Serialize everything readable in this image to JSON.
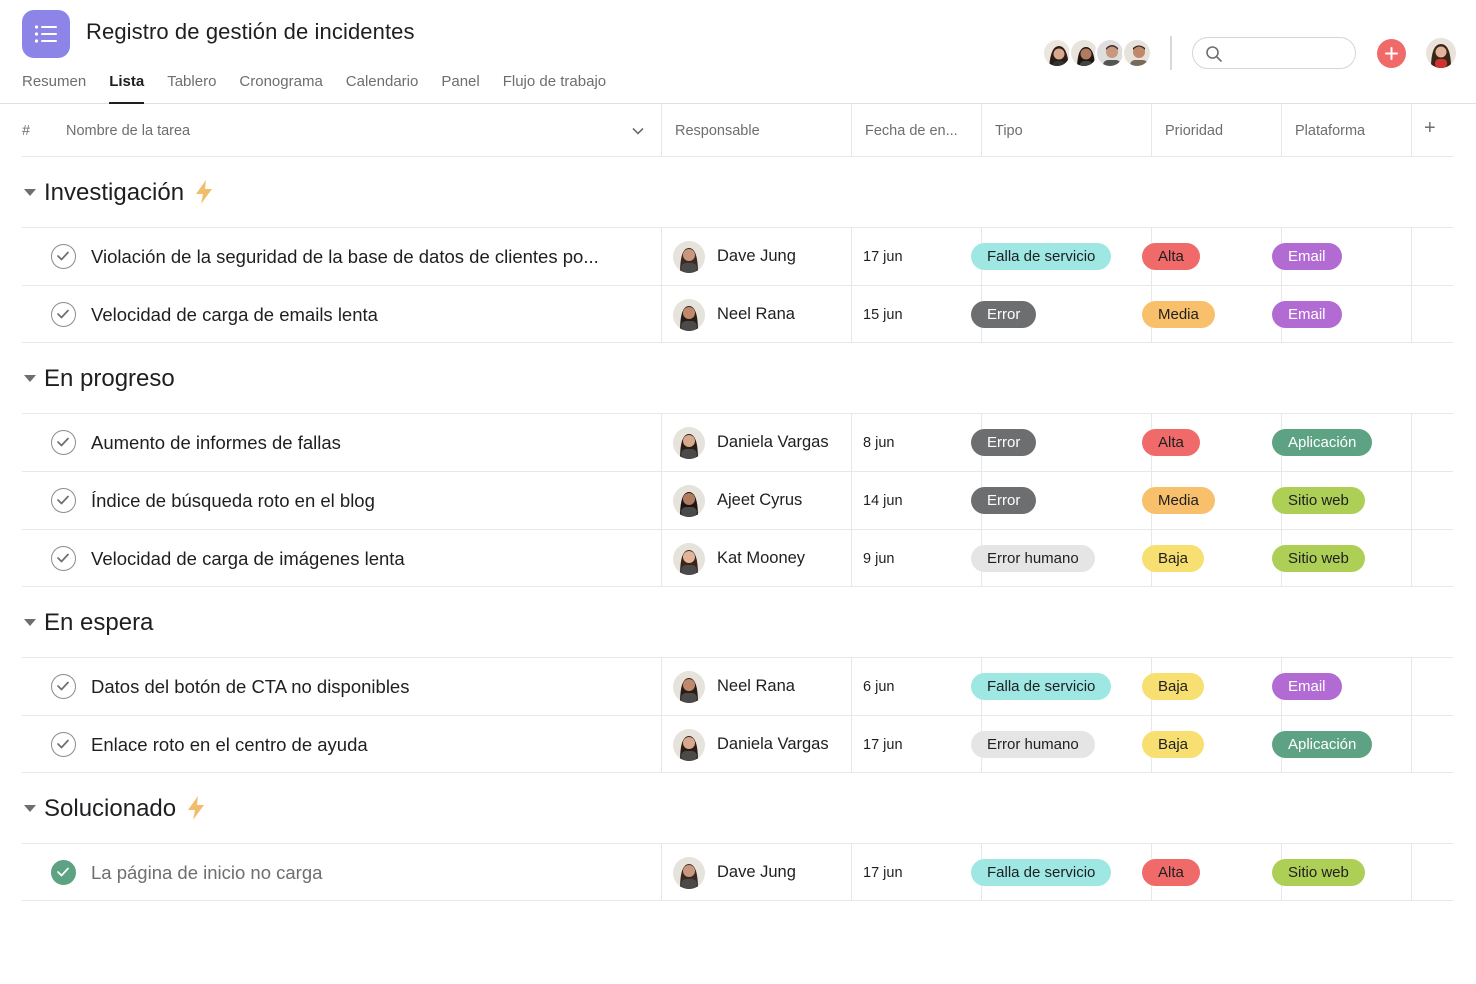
{
  "app": {
    "title": "Registro de gestión de incidentes",
    "tabs": [
      "Resumen",
      "Lista",
      "Tablero",
      "Cronograma",
      "Calendario",
      "Panel",
      "Flujo de trabajo"
    ],
    "active_tab": "Lista",
    "accent_color": "#8d84e8",
    "add_color": "#f06a6a"
  },
  "table": {
    "headers": {
      "number": "#",
      "task_name": "Nombre de la tarea",
      "assignee": "Responsable",
      "due_date": "Fecha de en...",
      "type": "Tipo",
      "priority": "Prioridad",
      "platform": "Plataforma",
      "add_column": "+"
    }
  },
  "sections": [
    {
      "title": "Investigación",
      "has_bolt": true,
      "tasks": [
        {
          "name": "Violación de la seguridad de la base de datos de clientes po...",
          "done": false,
          "assignee": "Dave Jung",
          "date": "17 jun",
          "type": "Falla de servicio",
          "priority": "Alta",
          "platform": "Email"
        },
        {
          "name": "Velocidad de carga de emails lenta",
          "done": false,
          "assignee": "Neel Rana",
          "date": "15 jun",
          "type": "Error",
          "priority": "Media",
          "platform": "Email"
        }
      ]
    },
    {
      "title": "En progreso",
      "has_bolt": false,
      "tasks": [
        {
          "name": "Aumento de informes de fallas",
          "done": false,
          "assignee": "Daniela Vargas",
          "date": "8 jun",
          "type": "Error",
          "priority": "Alta",
          "platform": "Aplicación"
        },
        {
          "name": "Índice de búsqueda roto en el blog",
          "done": false,
          "assignee": "Ajeet Cyrus",
          "date": "14 jun",
          "type": "Error",
          "priority": "Media",
          "platform": "Sitio web"
        },
        {
          "name": "Velocidad de carga de imágenes lenta",
          "done": false,
          "assignee": "Kat Mooney",
          "date": "9 jun",
          "type": "Error humano",
          "priority": "Baja",
          "platform": "Sitio web"
        }
      ]
    },
    {
      "title": "En espera",
      "has_bolt": false,
      "tasks": [
        {
          "name": "Datos del botón de CTA no disponibles",
          "done": false,
          "assignee": "Neel Rana",
          "date": "6 jun",
          "type": "Falla de servicio",
          "priority": "Baja",
          "platform": "Email"
        },
        {
          "name": "Enlace roto en el centro de ayuda",
          "done": false,
          "assignee": "Daniela Vargas",
          "date": "17 jun",
          "type": "Error humano",
          "priority": "Baja",
          "platform": "Aplicación"
        }
      ]
    },
    {
      "title": "Solucionado",
      "has_bolt": true,
      "tasks": [
        {
          "name": "La página de inicio no carga",
          "done": true,
          "assignee": "Dave Jung",
          "date": "17 jun",
          "type": "Falla de servicio",
          "priority": "Alta",
          "platform": "Sitio web"
        }
      ]
    }
  ],
  "tag_colors": {
    "Falla de servicio": {
      "bg": "#9ee7e3",
      "fg": "#1e1f21"
    },
    "Error": {
      "bg": "#6d6e6f",
      "fg": "#ffffff"
    },
    "Error humano": {
      "bg": "#e5e5e5",
      "fg": "#1e1f21"
    },
    "Alta": {
      "bg": "#f06a6a",
      "fg": "#1e1f21"
    },
    "Media": {
      "bg": "#f8c06a",
      "fg": "#1e1f21"
    },
    "Baja": {
      "bg": "#f8df72",
      "fg": "#1e1f21"
    },
    "Email": {
      "bg": "#b36bd4",
      "fg": "#ffffff"
    },
    "Aplicación": {
      "bg": "#5da283",
      "fg": "#ffffff"
    },
    "Sitio web": {
      "bg": "#aecf55",
      "fg": "#1e1f21"
    }
  },
  "avatars": {
    "Dave Jung": {
      "skin": "#c9977d",
      "hair": "#3a2a22"
    },
    "Neel Rana": {
      "skin": "#c08a6a",
      "hair": "#2a1d17"
    },
    "Daniela Vargas": {
      "skin": "#d7a88c",
      "hair": "#2b1c16"
    },
    "Ajeet Cyrus": {
      "skin": "#b07b5e",
      "hair": "#1f1512"
    },
    "Kat Mooney": {
      "skin": "#e2b59b",
      "hair": "#3b2418"
    }
  }
}
